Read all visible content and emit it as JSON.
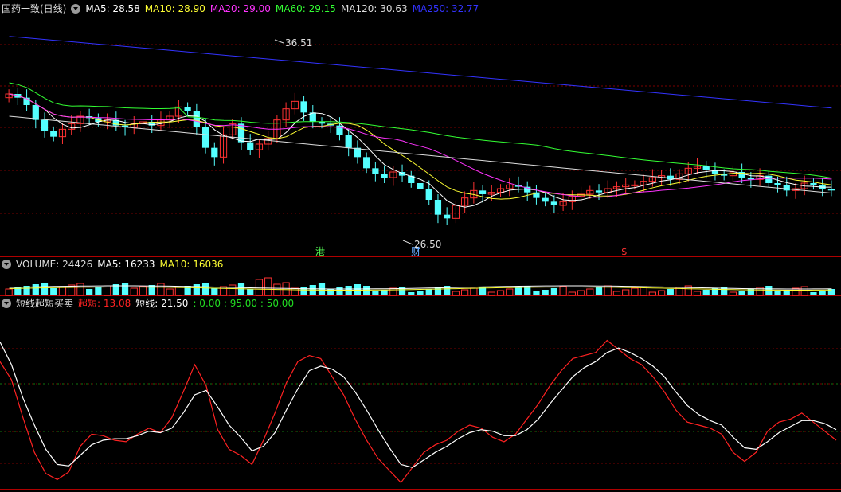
{
  "main_panel": {
    "title": "国药一致(日线)",
    "ma": [
      {
        "label": "MA5: 28.58",
        "color": "#ffffff"
      },
      {
        "label": "MA10: 28.90",
        "color": "#ffff33"
      },
      {
        "label": "MA20: 29.00",
        "color": "#ff33ff"
      },
      {
        "label": "MA60: 29.15",
        "color": "#33ff33"
      },
      {
        "label": "MA120: 30.63",
        "color": "#dddddd"
      },
      {
        "label": "MA250: 32.77",
        "color": "#3333ff"
      }
    ],
    "high_marker": "36.51",
    "low_marker": "26.50",
    "event_labels": [
      {
        "text": "港",
        "color": "#55ff55"
      },
      {
        "text": "财",
        "color": "#66aaff"
      },
      {
        "text": "$",
        "color": "#ff3333"
      }
    ]
  },
  "volume_panel": {
    "title": "VOLUME: 24426",
    "ma5": "MA5: 16233",
    "ma10": "MA10: 16036"
  },
  "indicator_panel": {
    "title": "短线超短买卖",
    "super_short": "超短: 13.08",
    "short": "短线: 21.50",
    "levels": ": 0.00 : 95.00 : 50.00"
  },
  "chart_data": [
    {
      "type": "candlestick",
      "title": "国药一致(日线)",
      "ylim": [
        26,
        38
      ],
      "high": 36.51,
      "low": 26.5,
      "close_series_approx": [
        33.8,
        33.6,
        33.2,
        32.4,
        31.8,
        31.5,
        31.9,
        32.2,
        32.6,
        32.5,
        32.3,
        32.4,
        32.1,
        32.0,
        32.2,
        32.3,
        32.1,
        32.4,
        32.6,
        33.1,
        32.9,
        32.0,
        30.9,
        30.4,
        31.6,
        32.2,
        31.2,
        30.8,
        31.1,
        31.4,
        32.4,
        33.0,
        33.4,
        32.8,
        32.3,
        32.2,
        32.1,
        31.6,
        30.9,
        30.4,
        29.8,
        29.5,
        29.3,
        29.6,
        29.4,
        29.0,
        28.7,
        28.1,
        27.3,
        27.1,
        27.8,
        28.2,
        28.6,
        28.4,
        28.5,
        28.7,
        28.9,
        28.8,
        28.5,
        28.2,
        28.0,
        27.8,
        28.0,
        28.3,
        28.4,
        28.6,
        28.5,
        28.7,
        28.8,
        28.9,
        28.9,
        29.1,
        29.3,
        29.4,
        29.2,
        29.5,
        29.8,
        29.9,
        29.7,
        29.5,
        29.4,
        29.6,
        29.3,
        29.2,
        29.4,
        29.0,
        28.9,
        28.6,
        28.7,
        29.0,
        28.9,
        28.7,
        28.6
      ]
    },
    {
      "type": "bar",
      "title": "VOLUME",
      "ma5": 16233,
      "ma10": 16036,
      "last": 24426
    },
    {
      "type": "line",
      "title": "短线超短买卖",
      "ylim": [
        0,
        100
      ],
      "levels": [
        0,
        50,
        95
      ],
      "series": [
        {
          "name": "超短",
          "color": "#ff2222",
          "values": [
            82,
            70,
            45,
            22,
            8,
            4,
            9,
            26,
            34,
            33,
            30,
            29,
            34,
            38,
            35,
            45,
            62,
            80,
            66,
            37,
            24,
            20,
            14,
            30,
            48,
            68,
            82,
            86,
            84,
            72,
            60,
            44,
            30,
            18,
            10,
            2,
            12,
            22,
            27,
            30,
            36,
            40,
            38,
            32,
            29,
            34,
            44,
            54,
            66,
            76,
            84,
            86,
            88,
            96,
            90,
            84,
            80,
            72,
            62,
            50,
            42,
            40,
            38,
            34,
            22,
            16,
            22,
            36,
            42,
            44,
            48,
            42,
            36,
            30
          ]
        },
        {
          "name": "短线",
          "color": "#ffffff",
          "values": [
            95,
            80,
            58,
            40,
            24,
            14,
            13,
            20,
            27,
            30,
            31,
            31,
            33,
            36,
            35,
            38,
            48,
            60,
            63,
            52,
            40,
            32,
            23,
            26,
            35,
            50,
            64,
            76,
            79,
            77,
            72,
            62,
            50,
            37,
            25,
            14,
            12,
            17,
            22,
            26,
            31,
            35,
            37,
            36,
            33,
            33,
            37,
            44,
            54,
            63,
            72,
            78,
            82,
            88,
            91,
            88,
            84,
            79,
            72,
            62,
            53,
            47,
            43,
            40,
            32,
            25,
            24,
            29,
            35,
            39,
            43,
            43,
            41,
            37
          ]
        }
      ]
    }
  ]
}
